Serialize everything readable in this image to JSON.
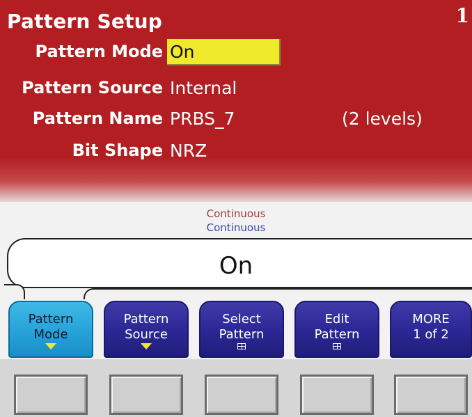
{
  "panel": {
    "title": "Pattern Setup",
    "channel": "1",
    "settings": [
      {
        "label": "Pattern Mode",
        "value": "On"
      },
      {
        "label": "Pattern Source",
        "value": "Internal"
      },
      {
        "label": "Pattern Name",
        "value": "PRBS_7",
        "note": "(2 levels)"
      },
      {
        "label": "Bit Shape",
        "value": "NRZ"
      }
    ]
  },
  "status": {
    "line1": "Continuous",
    "line2": "Continuous"
  },
  "value_display": "On",
  "softkeys": [
    {
      "line1": "Pattern",
      "line2": "Mode",
      "icon": "dropdown-arrow-icon"
    },
    {
      "line1": "Pattern",
      "line2": "Source",
      "icon": "dropdown-arrow-icon"
    },
    {
      "line1": "Select",
      "line2": "Pattern",
      "icon": "table-icon"
    },
    {
      "line1": "Edit",
      "line2": "Pattern",
      "icon": "table-icon"
    },
    {
      "line1": "MORE",
      "line2": "1 of 2",
      "icon": ""
    }
  ],
  "colors": {
    "panel_bg": "#b31e22",
    "highlight": "#f0ea2d",
    "softkey": "#2a2794",
    "softkey_active": "#24a0d8"
  }
}
